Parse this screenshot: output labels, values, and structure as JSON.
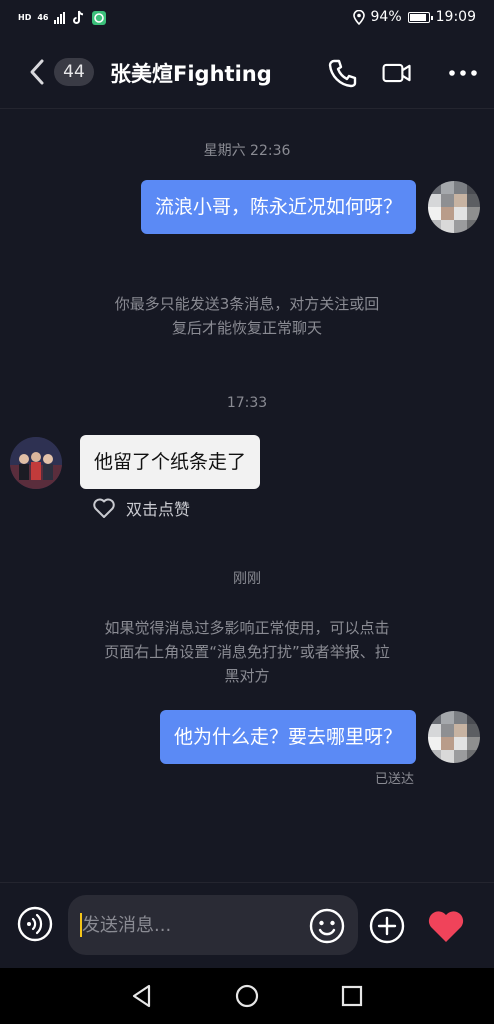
{
  "status_bar": {
    "hd": "HD",
    "network": "46",
    "battery_level": "94%",
    "battery_fraction": 0.94,
    "time": "19:09",
    "icons": [
      "signal-icon",
      "tiktok-icon",
      "chat-app-icon",
      "location-icon",
      "battery-icon"
    ]
  },
  "header": {
    "unread_count": "44",
    "title": "张美煊Fighting",
    "icons": [
      "back-icon",
      "phone-icon",
      "video-camera-icon",
      "more-icon"
    ]
  },
  "messages": [
    {
      "type": "timestamp",
      "text": "星期六 22:36"
    },
    {
      "type": "outgoing",
      "text": "流浪小哥，陈永近况如何呀？"
    },
    {
      "type": "system",
      "lines": [
        "你最多只能发送3条消息，对方关注或回",
        "复后才能恢复正常聊天"
      ]
    },
    {
      "type": "timestamp",
      "text": "17:33"
    },
    {
      "type": "incoming",
      "text": "他留了个纸条走了",
      "like_label": "双击点赞"
    },
    {
      "type": "timestamp",
      "text": "刚刚"
    },
    {
      "type": "system",
      "lines": [
        "如果觉得消息过多影响正常使用，可以点击",
        "页面右上角设置“消息免打扰”或者举报、拉",
        "黑对方"
      ]
    },
    {
      "type": "outgoing",
      "text": "他为什么走？要去哪里呀？",
      "status": "已送达"
    }
  ],
  "input_bar": {
    "placeholder": "发送消息...",
    "icons": [
      "voice-icon",
      "emoji-icon",
      "plus-icon",
      "heart-icon"
    ],
    "heart_color": "#f0435a"
  },
  "colors": {
    "background": "#161823",
    "outgoing_bubble": "#5b8af5",
    "incoming_bubble": "#f2f2f2",
    "muted_text": "#8a8b93"
  },
  "nav_bar": {
    "icons": [
      "back-triangle-icon",
      "home-circle-icon",
      "recents-square-icon"
    ]
  }
}
